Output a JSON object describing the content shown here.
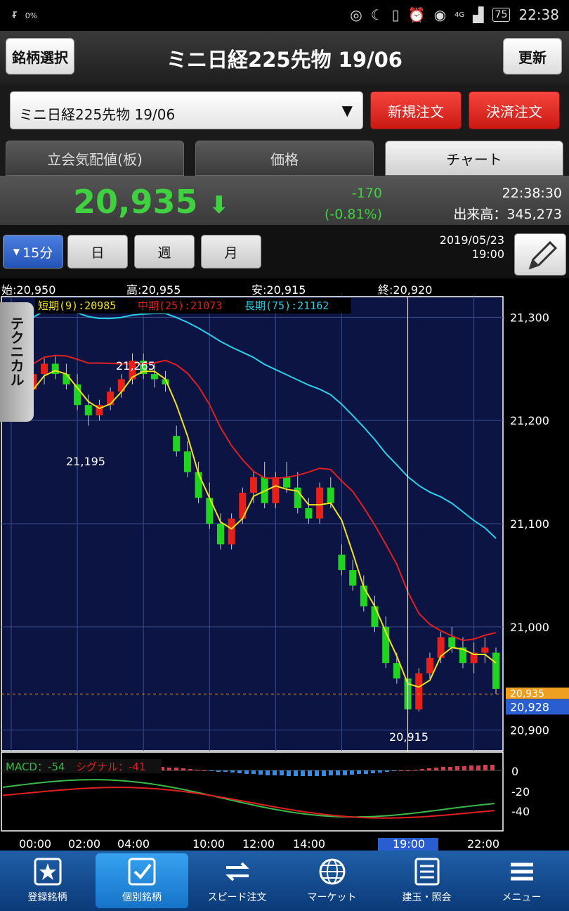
{
  "status_bar": {
    "left": "0%",
    "time": "22:38",
    "battery": "75",
    "signal": "4G"
  },
  "header": {
    "select_stock_label": "銘柄選択",
    "title": "ミニ日経225先物 19/06",
    "refresh_label": "更新"
  },
  "order": {
    "instrument": "ミニ日経225先物 19/06",
    "new_order_label": "新規注文",
    "settle_order_label": "決済注文"
  },
  "tabs": [
    "立会気配値(板)",
    "価格",
    "チャート"
  ],
  "active_tab": 2,
  "quote": {
    "price": "20,935",
    "arrow": "⬇",
    "change": "-170",
    "change_pct": "(-0.81%)",
    "time": "22:38:30",
    "volume_label": "出来高：345,273"
  },
  "period": {
    "buttons": [
      "15分",
      "日",
      "週",
      "月"
    ],
    "selected": 0,
    "date": "2019/05/23",
    "time": "19:00"
  },
  "ohlc": {
    "open": "始:20,950",
    "high": "高:20,955",
    "low": "安:20,915",
    "close": "終:20,920"
  },
  "technical_label": "テクニカル",
  "legend": {
    "short": "短期(9):20985",
    "mid": "中期(25):21073",
    "long": "長期(75):21162"
  },
  "macd_legend": {
    "macd": "MACD：-54",
    "signal": "シグナル：-41"
  },
  "annotations": {
    "high1": "21,265",
    "low1": "21,195",
    "low2": "20,915"
  },
  "price_ticks": [
    "21,300",
    "21,200",
    "21,100",
    "21,000",
    "20,900"
  ],
  "price_markers": {
    "current": "20,935",
    "close": "20,928"
  },
  "macd_ticks": [
    "0",
    "-20",
    "-40"
  ],
  "time_ticks": [
    "00:00",
    "02:00",
    "04:00",
    "10:00",
    "12:00",
    "14:00",
    "19:00",
    "22:00"
  ],
  "colors": {
    "up": "#e8201a",
    "down": "#22d422",
    "short_ma": "#f2e21a",
    "mid_ma": "#e0201e",
    "long_ma": "#28d0e8",
    "bg": "#0c1443"
  },
  "nav": [
    {
      "label": "登録銘柄",
      "icon": "star-icon"
    },
    {
      "label": "個別銘柄",
      "icon": "check-icon"
    },
    {
      "label": "スピード注文",
      "icon": "swap-icon"
    },
    {
      "label": "マーケット",
      "icon": "globe-icon"
    },
    {
      "label": "建玉・照会",
      "icon": "list-icon"
    },
    {
      "label": "メニュー",
      "icon": "menu-icon"
    }
  ],
  "active_nav": 1,
  "chart_data": {
    "type": "candlestick",
    "interval": "15分",
    "ylim": [
      20880,
      21320
    ],
    "moving_averages": [
      {
        "name": "短期(9)",
        "last": 20985
      },
      {
        "name": "中期(25)",
        "last": 21073
      },
      {
        "name": "長期(75)",
        "last": 21162
      }
    ],
    "candles": [
      [
        21225,
        21240,
        21205,
        21215
      ],
      [
        21215,
        21235,
        21200,
        21230
      ],
      [
        21230,
        21255,
        21220,
        21245
      ],
      [
        21245,
        21260,
        21235,
        21255
      ],
      [
        21255,
        21262,
        21240,
        21245
      ],
      [
        21245,
        21255,
        21230,
        21235
      ],
      [
        21235,
        21245,
        21210,
        21215
      ],
      [
        21215,
        21225,
        21195,
        21205
      ],
      [
        21205,
        21220,
        21200,
        21215
      ],
      [
        21215,
        21232,
        21210,
        21228
      ],
      [
        21228,
        21245,
        21222,
        21240
      ],
      [
        21240,
        21265,
        21235,
        21258
      ],
      [
        21258,
        21265,
        21240,
        21245
      ],
      [
        21245,
        21255,
        21232,
        21240
      ],
      [
        21240,
        21248,
        21228,
        21235
      ],
      [
        21185,
        21195,
        21165,
        21170
      ],
      [
        21170,
        21180,
        21145,
        21150
      ],
      [
        21150,
        21160,
        21120,
        21125
      ],
      [
        21125,
        21140,
        21095,
        21100
      ],
      [
        21100,
        21110,
        21075,
        21080
      ],
      [
        21080,
        21110,
        21075,
        21105
      ],
      [
        21105,
        21135,
        21100,
        21130
      ],
      [
        21130,
        21150,
        21120,
        21145
      ],
      [
        21145,
        21160,
        21115,
        21120
      ],
      [
        21120,
        21150,
        21115,
        21145
      ],
      [
        21145,
        21160,
        21130,
        21135
      ],
      [
        21135,
        21150,
        21110,
        21115
      ],
      [
        21115,
        21125,
        21100,
        21105
      ],
      [
        21105,
        21140,
        21100,
        21135
      ],
      [
        21135,
        21145,
        21115,
        21120
      ],
      [
        21070,
        21080,
        21050,
        21055
      ],
      [
        21055,
        21065,
        21035,
        21040
      ],
      [
        21040,
        21050,
        21015,
        21020
      ],
      [
        21020,
        21030,
        20995,
        21000
      ],
      [
        21000,
        21010,
        20960,
        20965
      ],
      [
        20965,
        20975,
        20945,
        20950
      ],
      [
        20950,
        20960,
        20915,
        20920
      ],
      [
        20920,
        20960,
        20918,
        20955
      ],
      [
        20955,
        20975,
        20950,
        20970
      ],
      [
        20970,
        20995,
        20965,
        20990
      ],
      [
        20990,
        21000,
        20975,
        20980
      ],
      [
        20980,
        20990,
        20960,
        20965
      ],
      [
        20965,
        20985,
        20955,
        20975
      ],
      [
        20975,
        20990,
        20965,
        20980
      ],
      [
        20975,
        20980,
        20935,
        20940
      ]
    ],
    "macd": {
      "macd_last": -54,
      "signal_last": -41
    }
  }
}
